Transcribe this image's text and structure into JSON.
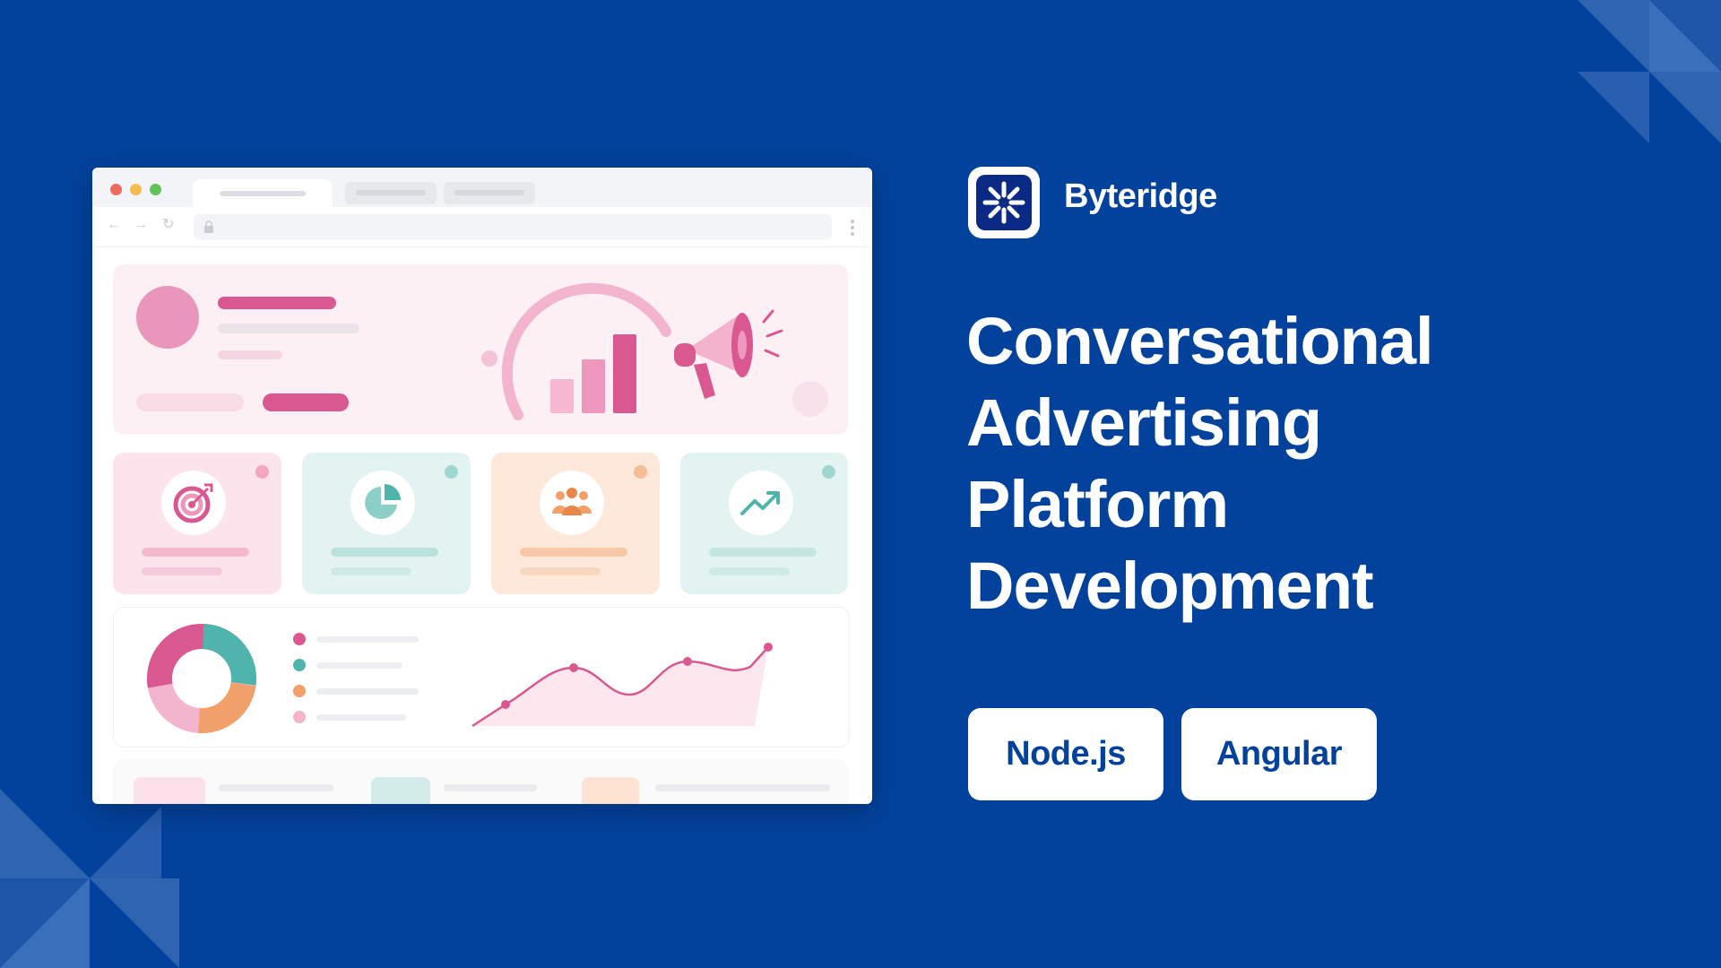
{
  "brand": {
    "name": "Byteridge",
    "logo": "asterisk-logo-icon"
  },
  "headline": {
    "lines": [
      "Conversational",
      "Advertising",
      "Platform",
      "Development"
    ]
  },
  "tags": [
    {
      "label": "Node.js"
    },
    {
      "label": "Angular"
    }
  ],
  "colors": {
    "background": "#03429c",
    "accent_pink": "#d9588f",
    "accent_teal": "#4fb5ac",
    "accent_orange": "#f2a069"
  },
  "mockup": {
    "icons": [
      "target-icon",
      "pie-chart-icon",
      "people-icon",
      "trend-up-icon",
      "megaphone-icon"
    ]
  }
}
